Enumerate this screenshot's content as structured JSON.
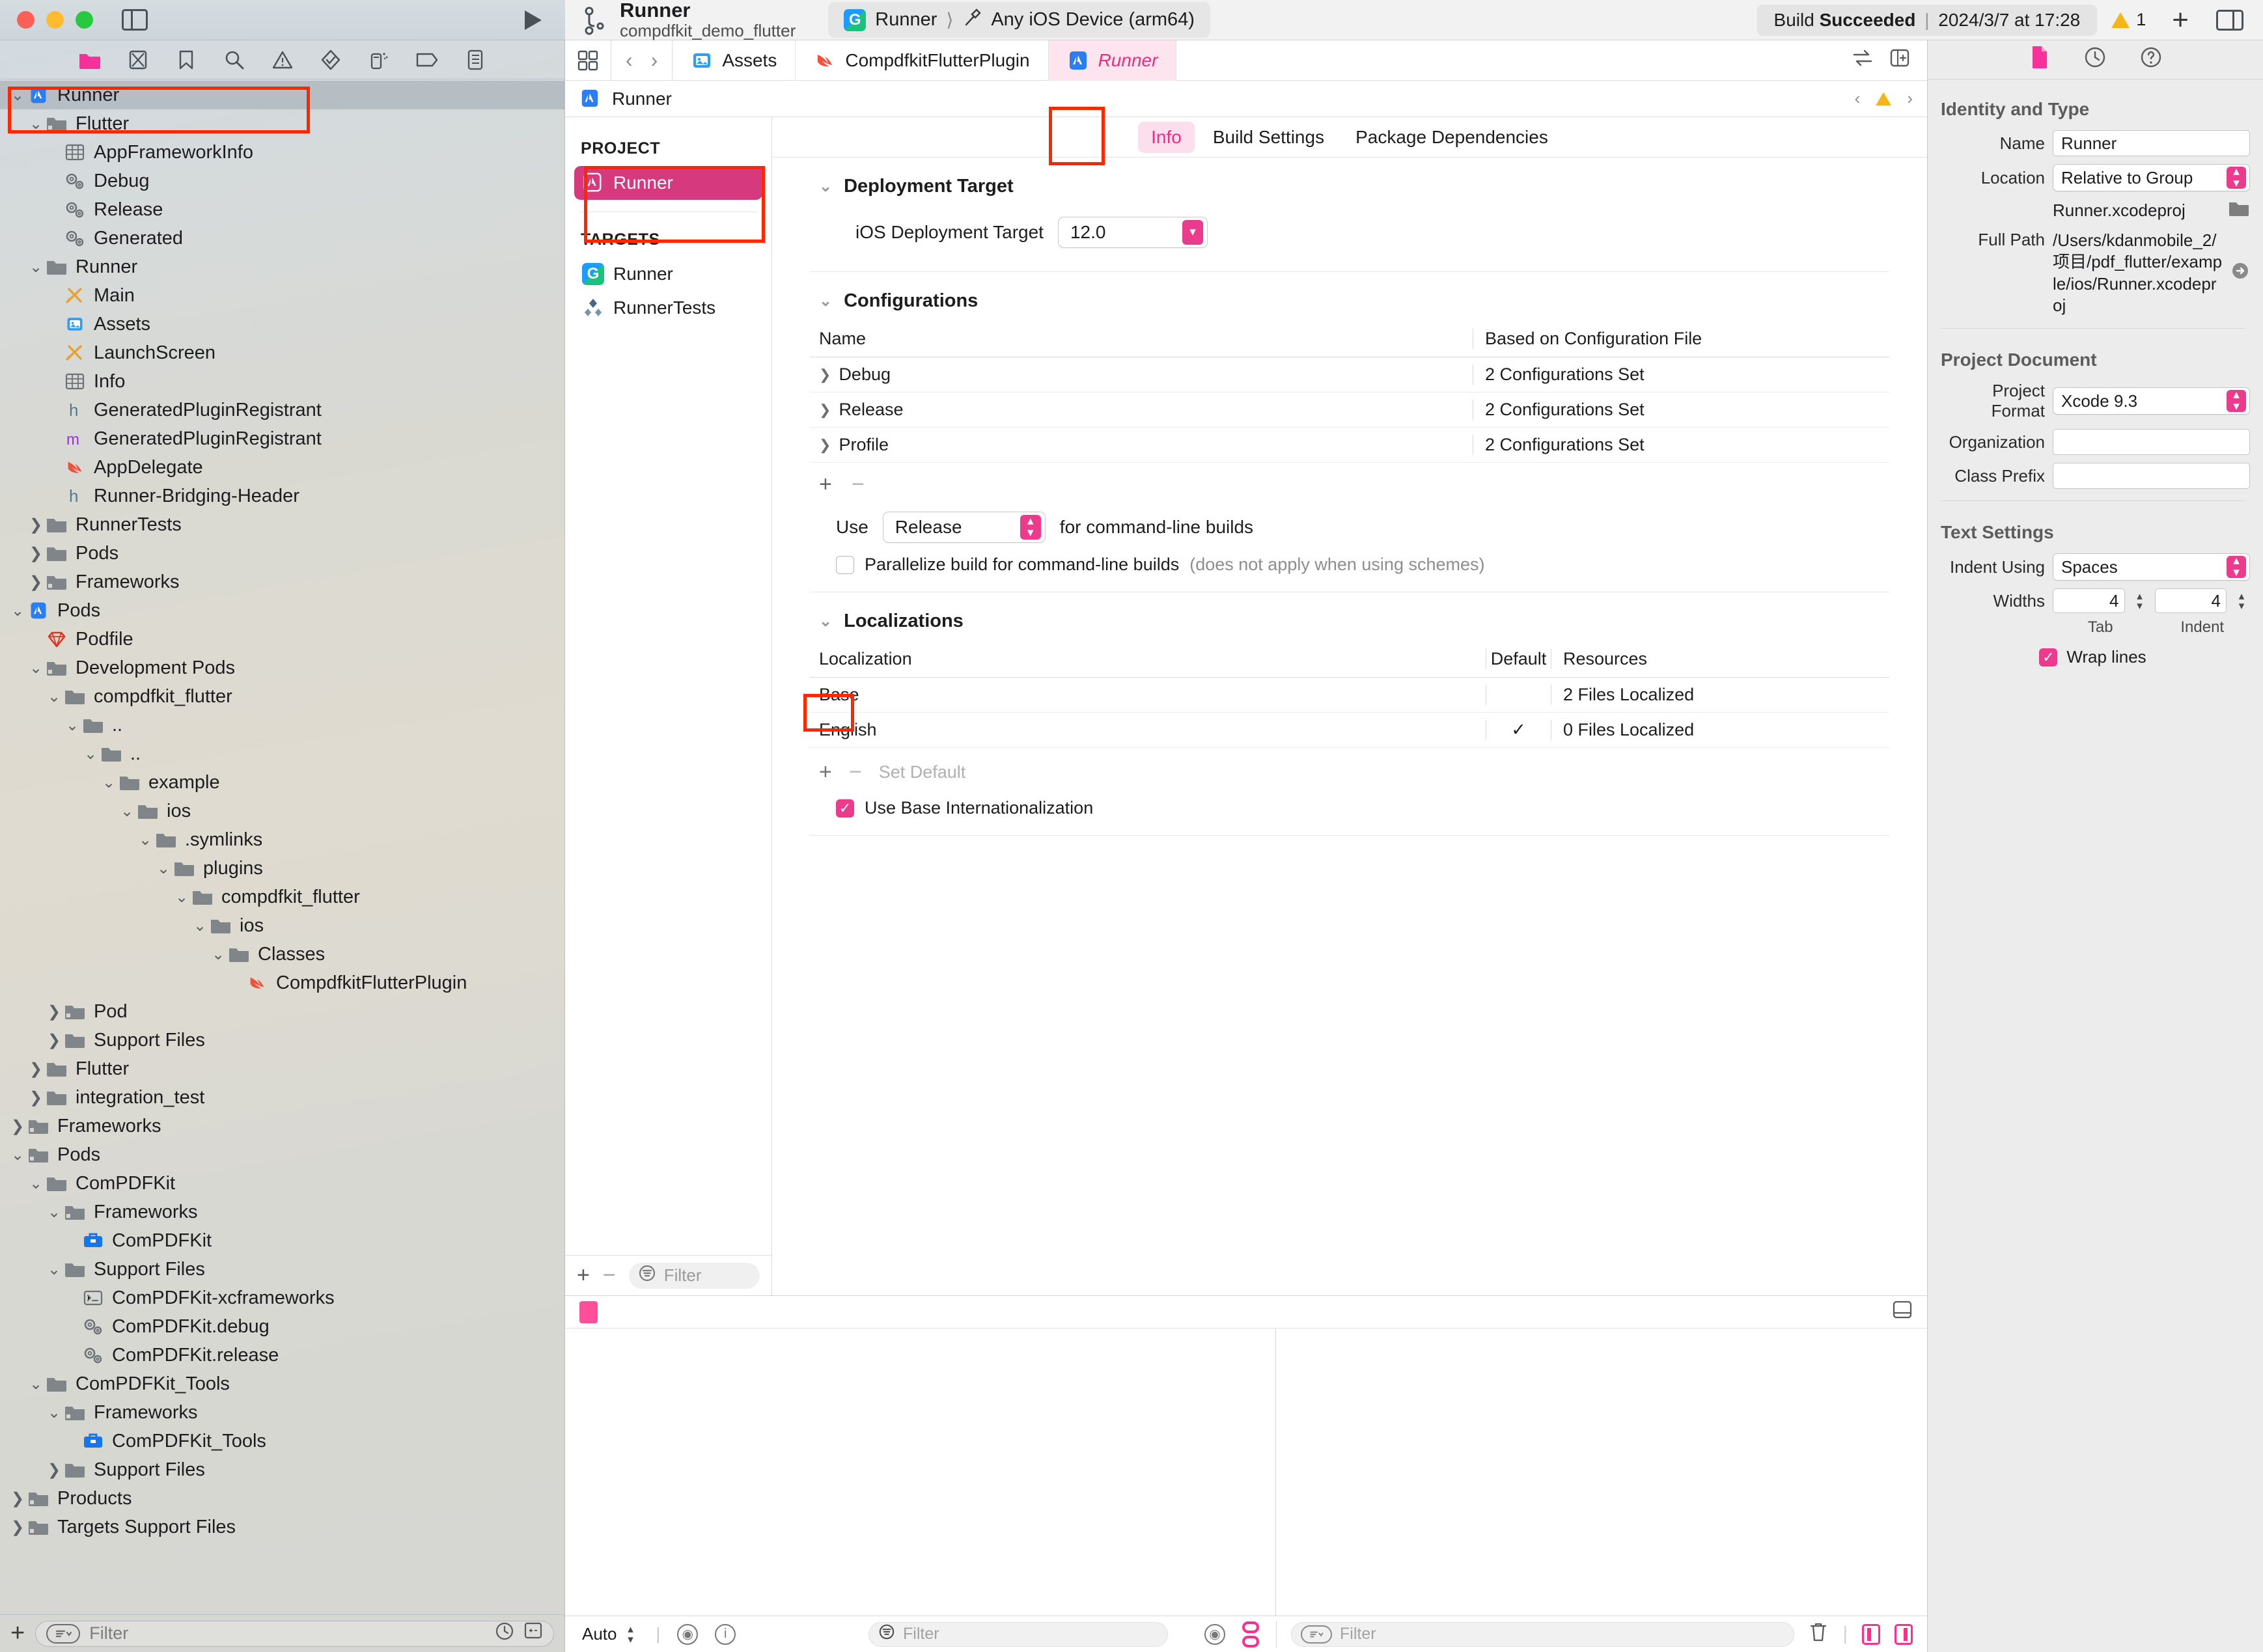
{
  "window": {
    "traffic_lights": [
      "close",
      "minimize",
      "zoom"
    ],
    "run_label": "Run"
  },
  "toolbar": {
    "project_name": "Runner",
    "workspace_name": "compdfkit_demo_flutter",
    "scheme": "Runner",
    "destination": "Any iOS Device (arm64)",
    "build_status_prefix": "Build ",
    "build_status_strong": "Succeeded",
    "build_status_sep": " | ",
    "build_status_time": "2024/3/7 at 17:28",
    "warning_count": "1",
    "add_label": "+"
  },
  "navigator": {
    "icons": [
      "folder-icon",
      "source-control-icon",
      "bookmark-icon",
      "search-icon",
      "warning-icon",
      "test-icon",
      "debug-icon",
      "breakpoint-icon",
      "report-icon"
    ],
    "tree": [
      {
        "label": "Runner",
        "depth": 0,
        "disclosure": "down",
        "icon": "xcode-project-icon",
        "selected": true
      },
      {
        "label": "Flutter",
        "depth": 1,
        "disclosure": "down",
        "icon": "folder-ref-icon"
      },
      {
        "label": "AppFrameworkInfo",
        "depth": 2,
        "disclosure": "none",
        "icon": "plist-icon"
      },
      {
        "label": "Debug",
        "depth": 2,
        "disclosure": "none",
        "icon": "xcconfig-icon"
      },
      {
        "label": "Release",
        "depth": 2,
        "disclosure": "none",
        "icon": "xcconfig-icon"
      },
      {
        "label": "Generated",
        "depth": 2,
        "disclosure": "none",
        "icon": "xcconfig-icon"
      },
      {
        "label": "Runner",
        "depth": 1,
        "disclosure": "down",
        "icon": "folder-icon"
      },
      {
        "label": "Main",
        "depth": 2,
        "disclosure": "none",
        "icon": "storyboard-icon"
      },
      {
        "label": "Assets",
        "depth": 2,
        "disclosure": "none",
        "icon": "assets-icon"
      },
      {
        "label": "LaunchScreen",
        "depth": 2,
        "disclosure": "none",
        "icon": "storyboard-icon"
      },
      {
        "label": "Info",
        "depth": 2,
        "disclosure": "none",
        "icon": "plist-icon"
      },
      {
        "label": "GeneratedPluginRegistrant",
        "depth": 2,
        "disclosure": "none",
        "icon": "h-file-icon"
      },
      {
        "label": "GeneratedPluginRegistrant",
        "depth": 2,
        "disclosure": "none",
        "icon": "m-file-icon"
      },
      {
        "label": "AppDelegate",
        "depth": 2,
        "disclosure": "none",
        "icon": "swift-file-icon"
      },
      {
        "label": "Runner-Bridging-Header",
        "depth": 2,
        "disclosure": "none",
        "icon": "h-file-icon"
      },
      {
        "label": "RunnerTests",
        "depth": 1,
        "disclosure": "right",
        "icon": "folder-icon"
      },
      {
        "label": "Pods",
        "depth": 1,
        "disclosure": "right",
        "icon": "folder-icon"
      },
      {
        "label": "Frameworks",
        "depth": 1,
        "disclosure": "right",
        "icon": "folder-ref-icon"
      },
      {
        "label": "Pods",
        "depth": 0,
        "disclosure": "down",
        "icon": "xcode-project-icon"
      },
      {
        "label": "Podfile",
        "depth": 1,
        "disclosure": "none",
        "icon": "ruby-icon"
      },
      {
        "label": "Development Pods",
        "depth": 1,
        "disclosure": "down",
        "icon": "folder-ref-icon"
      },
      {
        "label": "compdfkit_flutter",
        "depth": 2,
        "disclosure": "down",
        "icon": "folder-icon"
      },
      {
        "label": "..",
        "depth": 3,
        "disclosure": "down",
        "icon": "folder-icon"
      },
      {
        "label": "..",
        "depth": 4,
        "disclosure": "down",
        "icon": "folder-icon"
      },
      {
        "label": "example",
        "depth": 5,
        "disclosure": "down",
        "icon": "folder-icon"
      },
      {
        "label": "ios",
        "depth": 6,
        "disclosure": "down",
        "icon": "folder-icon"
      },
      {
        "label": ".symlinks",
        "depth": 7,
        "disclosure": "down",
        "icon": "folder-icon"
      },
      {
        "label": "plugins",
        "depth": 8,
        "disclosure": "down",
        "icon": "folder-icon"
      },
      {
        "label": "compdfkit_flutter",
        "depth": 9,
        "disclosure": "down",
        "icon": "folder-icon"
      },
      {
        "label": "ios",
        "depth": 10,
        "disclosure": "down",
        "icon": "folder-icon"
      },
      {
        "label": "Classes",
        "depth": 11,
        "disclosure": "down",
        "icon": "folder-icon"
      },
      {
        "label": "CompdfkitFlutterPlugin",
        "depth": 12,
        "disclosure": "none",
        "icon": "swift-file-icon"
      },
      {
        "label": "Pod",
        "depth": 2,
        "disclosure": "right",
        "icon": "folder-ref-icon"
      },
      {
        "label": "Support Files",
        "depth": 2,
        "disclosure": "right",
        "icon": "folder-icon"
      },
      {
        "label": "Flutter",
        "depth": 1,
        "disclosure": "right",
        "icon": "folder-icon"
      },
      {
        "label": "integration_test",
        "depth": 1,
        "disclosure": "right",
        "icon": "folder-icon"
      },
      {
        "label": "Frameworks",
        "depth": 0,
        "disclosure": "right",
        "icon": "folder-ref-icon"
      },
      {
        "label": "Pods",
        "depth": 0,
        "disclosure": "down",
        "icon": "folder-ref-icon"
      },
      {
        "label": "ComPDFKit",
        "depth": 1,
        "disclosure": "down",
        "icon": "folder-icon"
      },
      {
        "label": "Frameworks",
        "depth": 2,
        "disclosure": "down",
        "icon": "folder-ref-icon"
      },
      {
        "label": "ComPDFKit",
        "depth": 3,
        "disclosure": "none",
        "icon": "framework-icon"
      },
      {
        "label": "Support Files",
        "depth": 2,
        "disclosure": "down",
        "icon": "folder-icon"
      },
      {
        "label": "ComPDFKit-xcframeworks",
        "depth": 3,
        "disclosure": "none",
        "icon": "shell-icon"
      },
      {
        "label": "ComPDFKit.debug",
        "depth": 3,
        "disclosure": "none",
        "icon": "xcconfig-icon"
      },
      {
        "label": "ComPDFKit.release",
        "depth": 3,
        "disclosure": "none",
        "icon": "xcconfig-icon"
      },
      {
        "label": "ComPDFKit_Tools",
        "depth": 1,
        "disclosure": "down",
        "icon": "folder-icon"
      },
      {
        "label": "Frameworks",
        "depth": 2,
        "disclosure": "down",
        "icon": "folder-ref-icon"
      },
      {
        "label": "ComPDFKit_Tools",
        "depth": 3,
        "disclosure": "none",
        "icon": "framework-icon"
      },
      {
        "label": "Support Files",
        "depth": 2,
        "disclosure": "right",
        "icon": "folder-icon"
      },
      {
        "label": "Products",
        "depth": 0,
        "disclosure": "right",
        "icon": "folder-ref-icon"
      },
      {
        "label": "Targets Support Files",
        "depth": 0,
        "disclosure": "right",
        "icon": "folder-ref-icon"
      }
    ],
    "bottom": {
      "add_label": "+",
      "filter_placeholder": "Filter",
      "recent_icon": "clock-icon",
      "split_icon": "split-icon"
    }
  },
  "editor": {
    "tabs": [
      {
        "label": "Assets",
        "icon": "assets-icon",
        "active": false
      },
      {
        "label": "CompdfkitFlutterPlugin",
        "icon": "swift-file-icon",
        "active": false
      },
      {
        "label": "Runner",
        "icon": "xcode-project-icon",
        "active": true
      }
    ],
    "jumpbar": {
      "title": "Runner",
      "icon": "xcode-project-icon",
      "warning_count": "1"
    },
    "project_pane": {
      "project_header": "PROJECT",
      "project_items": [
        {
          "label": "Runner",
          "icon": "xcode-project-icon",
          "selected": true
        }
      ],
      "targets_header": "TARGETS",
      "target_items": [
        {
          "label": "Runner",
          "icon": "app-target-icon"
        },
        {
          "label": "RunnerTests",
          "icon": "test-target-icon"
        }
      ],
      "bottom": {
        "add_label": "+",
        "remove_label": "−",
        "filter_placeholder": "Filter"
      }
    },
    "content_tabs": [
      {
        "label": "Info",
        "active": true
      },
      {
        "label": "Build Settings",
        "active": false
      },
      {
        "label": "Package Dependencies",
        "active": false
      }
    ],
    "deployment_target": {
      "section_title": "Deployment Target",
      "label": "iOS Deployment Target",
      "value": "12.0"
    },
    "configurations": {
      "section_title": "Configurations",
      "columns": [
        "Name",
        "Based on Configuration File"
      ],
      "rows": [
        {
          "name": "Debug",
          "based_on": "2 Configurations Set"
        },
        {
          "name": "Release",
          "based_on": "2 Configurations Set"
        },
        {
          "name": "Profile",
          "based_on": "2 Configurations Set"
        }
      ],
      "add_label": "+",
      "remove_label": "−",
      "use_prefix": "Use",
      "use_value": "Release",
      "use_suffix": "for command-line builds",
      "parallelize_label": "Parallelize build for command-line builds",
      "parallelize_note": "(does not apply when using schemes)",
      "parallelize_checked": false
    },
    "localizations": {
      "section_title": "Localizations",
      "columns": [
        "Localization",
        "Default",
        "Resources"
      ],
      "rows": [
        {
          "name": "Base",
          "default": "",
          "resources": "2 Files Localized"
        },
        {
          "name": "English",
          "default": "✓",
          "resources": "0 Files Localized"
        }
      ],
      "add_label": "+",
      "remove_label": "−",
      "set_default_label": "Set Default",
      "base_intl_label": "Use Base Internationalization",
      "base_intl_checked": true
    }
  },
  "debug_area": {
    "left_filter_placeholder": "Filter",
    "right_filter_placeholder": "Filter",
    "auto_label": "Auto",
    "trash_icon": "trash-icon"
  },
  "inspector": {
    "tabs": [
      "file-inspector-icon",
      "history-inspector-icon",
      "help-inspector-icon"
    ],
    "identity": {
      "title": "Identity and Type",
      "name_label": "Name",
      "name_value": "Runner",
      "location_label": "Location",
      "location_value": "Relative to Group",
      "file_name": "Runner.xcodeproj",
      "full_path_label": "Full Path",
      "full_path_value": "/Users/kdanmobile_2/项目/pdf_flutter/example/ios/Runner.xcodeproj"
    },
    "project_document": {
      "title": "Project Document",
      "format_label": "Project Format",
      "format_value": "Xcode 9.3",
      "organization_label": "Organization",
      "organization_value": "",
      "class_prefix_label": "Class Prefix",
      "class_prefix_value": ""
    },
    "text_settings": {
      "title": "Text Settings",
      "indent_label": "Indent Using",
      "indent_value": "Spaces",
      "widths_label": "Widths",
      "tab_value": "4",
      "indent_value_num": "4",
      "tab_sublabel": "Tab",
      "indent_sublabel": "Indent",
      "wrap_label": "Wrap lines",
      "wrap_checked": true
    }
  },
  "colors": {
    "accent_pink": "#ec3b8d",
    "tab_pink": "#f42b85",
    "annotation_red": "#ff2600",
    "warning_yellow": "#f5b514"
  }
}
